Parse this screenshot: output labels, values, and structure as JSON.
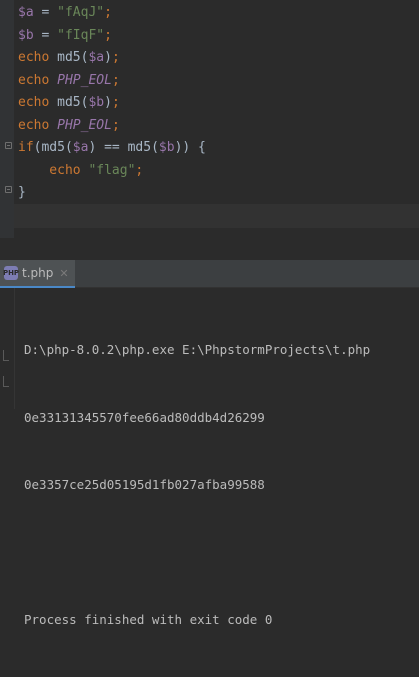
{
  "editor": {
    "lines": [
      {
        "parts": [
          {
            "t": "$a",
            "c": "var"
          },
          {
            "t": " = ",
            "c": "fn"
          },
          {
            "t": "\"fAqJ\"",
            "c": "str"
          },
          {
            "t": ";",
            "c": "kw"
          }
        ]
      },
      {
        "parts": [
          {
            "t": "$b",
            "c": "var"
          },
          {
            "t": " = ",
            "c": "fn"
          },
          {
            "t": "\"fIqF\"",
            "c": "str"
          },
          {
            "t": ";",
            "c": "kw"
          }
        ]
      },
      {
        "parts": [
          {
            "t": "echo ",
            "c": "kw"
          },
          {
            "t": "md5(",
            "c": "fn"
          },
          {
            "t": "$a",
            "c": "var"
          },
          {
            "t": ")",
            "c": "fn"
          },
          {
            "t": ";",
            "c": "kw"
          }
        ]
      },
      {
        "parts": [
          {
            "t": "echo ",
            "c": "kw"
          },
          {
            "t": "PHP_EOL",
            "c": "const"
          },
          {
            "t": ";",
            "c": "kw"
          }
        ]
      },
      {
        "parts": [
          {
            "t": "echo ",
            "c": "kw"
          },
          {
            "t": "md5(",
            "c": "fn"
          },
          {
            "t": "$b",
            "c": "var"
          },
          {
            "t": ")",
            "c": "fn"
          },
          {
            "t": ";",
            "c": "kw"
          }
        ]
      },
      {
        "parts": [
          {
            "t": "echo ",
            "c": "kw"
          },
          {
            "t": "PHP_EOL",
            "c": "const"
          },
          {
            "t": ";",
            "c": "kw"
          }
        ]
      },
      {
        "parts": [
          {
            "t": "if",
            "c": "kw"
          },
          {
            "t": "(md5(",
            "c": "fn"
          },
          {
            "t": "$a",
            "c": "var"
          },
          {
            "t": ") == md5(",
            "c": "fn"
          },
          {
            "t": "$b",
            "c": "var"
          },
          {
            "t": ")) {",
            "c": "fn"
          }
        ]
      },
      {
        "parts": [
          {
            "t": "    echo ",
            "c": "kw"
          },
          {
            "t": "\"flag\"",
            "c": "str"
          },
          {
            "t": ";",
            "c": "kw"
          }
        ]
      },
      {
        "parts": [
          {
            "t": "}",
            "c": "fn"
          }
        ]
      }
    ]
  },
  "run_tab": {
    "label": "t.php",
    "icon": "php-file-icon",
    "close_glyph": "✕"
  },
  "console": {
    "command": "D:\\php-8.0.2\\php.exe E:\\PhpstormProjects\\t.php",
    "hash_a": "0e33131345570fee66ad80ddb4d26299",
    "hash_b": "0e3357ce25d05195d1fb027afba99588",
    "exit_message": "Process finished with exit code 0"
  },
  "colors": {
    "background": "#2b2b2b",
    "keyword": "#cc7832",
    "string": "#6a8759",
    "variable": "#9876aa",
    "text": "#a9b7c6"
  }
}
